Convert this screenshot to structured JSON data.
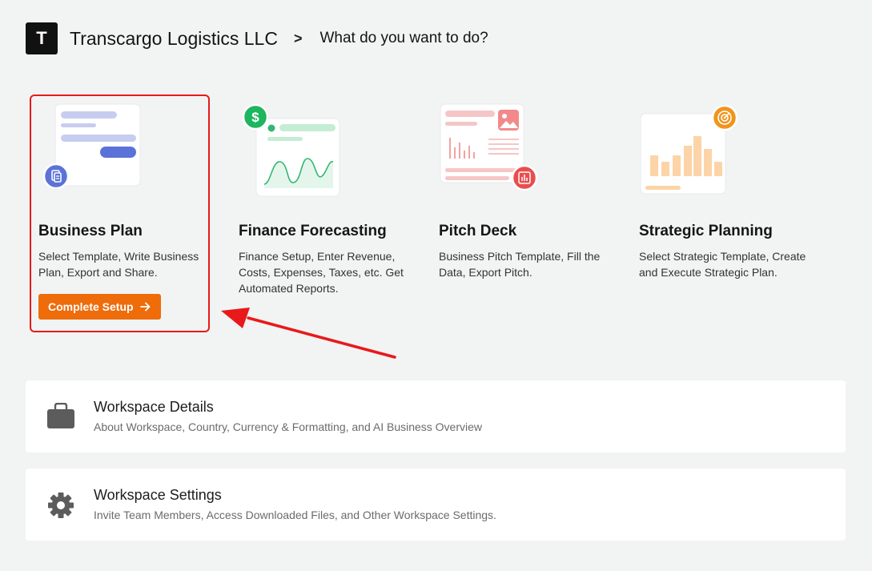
{
  "header": {
    "logo_letter": "T",
    "company": "Transcargo Logistics LLC",
    "separator": ">",
    "question": "What do you want to do?"
  },
  "cards": [
    {
      "title": "Business Plan",
      "desc": "Select Template, Write Business Plan, Export and Share.",
      "icon": "document-icon",
      "selected": true
    },
    {
      "title": "Finance Forecasting",
      "desc": "Finance Setup, Enter Revenue, Costs, Expenses, Taxes, etc. Get Automated Reports.",
      "icon": "dollar-icon"
    },
    {
      "title": "Pitch Deck",
      "desc": "Business Pitch Template, Fill the Data, Export Pitch.",
      "icon": "chart-icon"
    },
    {
      "title": "Strategic Planning",
      "desc": "Select Strategic Template, Create and Execute Strategic Plan.",
      "icon": "target-icon"
    }
  ],
  "setup_button": {
    "label": "Complete Setup",
    "icon": "arrow-right-icon",
    "color": "#ee6c0a"
  },
  "annotation": {
    "highlight_color": "#e8191a"
  },
  "panels": [
    {
      "title": "Workspace Details",
      "subtitle": "About Workspace, Country, Currency & Formatting, and AI Business Overview",
      "icon": "briefcase-icon"
    },
    {
      "title": "Workspace Settings",
      "subtitle": "Invite Team Members, Access Downloaded Files, and Other Workspace Settings.",
      "icon": "gear-icon"
    }
  ]
}
